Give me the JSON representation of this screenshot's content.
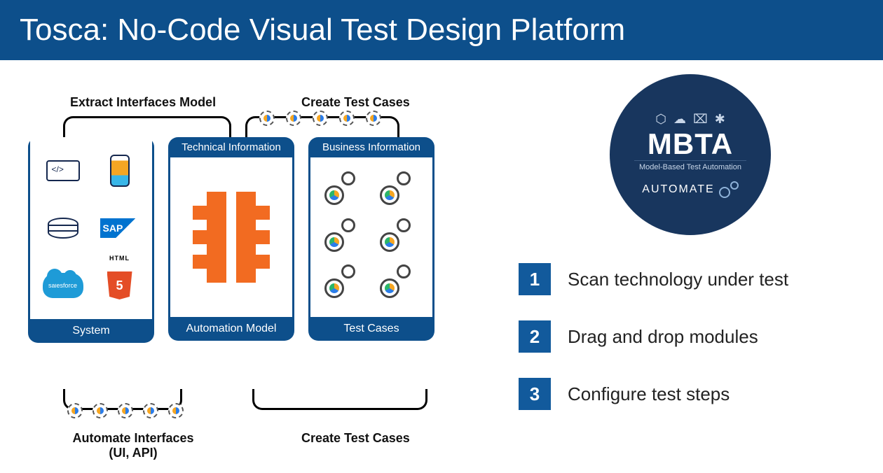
{
  "header": {
    "title": "Tosca: No-Code Visual Test Design Platform"
  },
  "diagram": {
    "label_extract": "Extract Interfaces Model",
    "label_create_top": "Create Test Cases",
    "label_automate": "Automate Interfaces",
    "label_automate_sub": "(UI, API)",
    "label_create_bottom": "Create Test Cases",
    "cards": {
      "system": {
        "header": "",
        "footer": "System",
        "icons": [
          "code-tag",
          "mobile",
          "database",
          "SAP",
          "salesforce",
          "HTML5"
        ]
      },
      "tech": {
        "header": "Technical Information",
        "footer": "Automation Model"
      },
      "biz": {
        "header": "Business Information",
        "footer": "Test Cases"
      }
    }
  },
  "mbta": {
    "title": "MBTA",
    "subtitle": "Model-Based Test Automation",
    "automate": "AUTOMATE",
    "icons": [
      "html5",
      "cloud",
      "devices",
      "asterisk"
    ]
  },
  "steps": [
    {
      "num": "1",
      "text": "Scan technology under test"
    },
    {
      "num": "2",
      "text": "Drag and drop modules"
    },
    {
      "num": "3",
      "text": "Configure test steps"
    }
  ],
  "colors": {
    "header_bg": "#0d4f8b",
    "card_bg": "#0d4f8b",
    "mbta_bg": "#18365e",
    "accent_orange": "#f26b21",
    "step_bg": "#125a9c"
  }
}
